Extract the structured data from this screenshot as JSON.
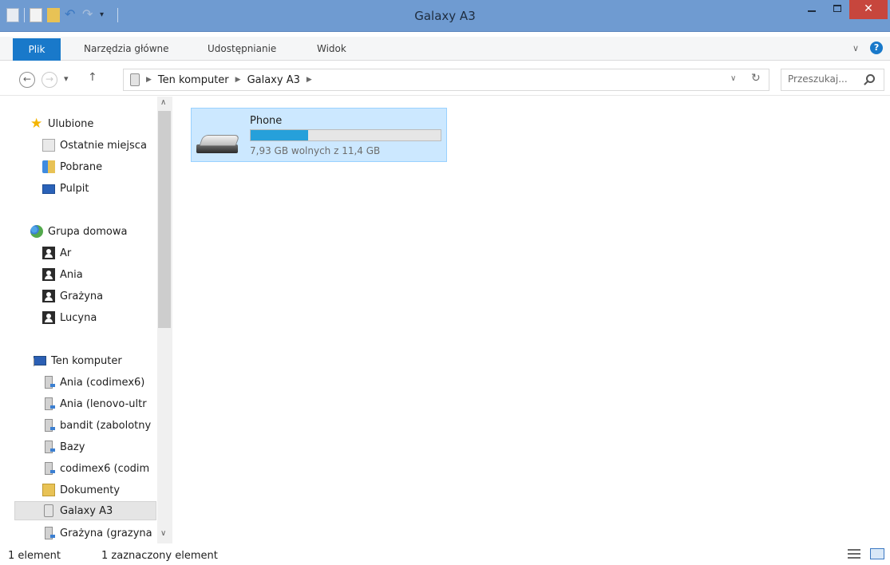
{
  "window": {
    "title": "Galaxy A3",
    "close_glyph": "✕"
  },
  "ribbon": {
    "file_tab": "Plik",
    "tabs": [
      "Narzędzia główne",
      "Udostępnianie",
      "Widok"
    ]
  },
  "navigation": {
    "back_glyph": "←",
    "forward_glyph": "→",
    "recent_glyph": "▾",
    "up_glyph": "↑",
    "breadcrumbs": [
      "Ten komputer",
      "Galaxy A3"
    ],
    "search_placeholder": "Przeszukaj..."
  },
  "sidebar": {
    "favorites": {
      "label": "Ulubione",
      "items": [
        "Ostatnie miejsca",
        "Pobrane",
        "Pulpit"
      ]
    },
    "homegroup": {
      "label": "Grupa domowa",
      "items": [
        "Ar",
        "Ania",
        "Grażyna",
        "Lucyna"
      ]
    },
    "computer": {
      "label": "Ten komputer",
      "items": [
        "Ania (codimex6)",
        "Ania (lenovo-ultr",
        "bandit (zabolotny",
        "Bazy",
        "codimex6 (codim",
        "Dokumenty",
        "Galaxy A3",
        "Grażyna (grazyna"
      ],
      "selected": "Galaxy A3"
    }
  },
  "content": {
    "drive": {
      "name": "Phone",
      "free_text": "7,93 GB wolnych z 11,4 GB",
      "used_fraction": 0.304
    }
  },
  "status_bar": {
    "count": "1 element",
    "selection": "1 zaznaczony element"
  },
  "colors": {
    "title_bar": "#6f9bd1",
    "file_tab": "#1979ca",
    "close_button": "#c7463d",
    "selection": "#cce8ff",
    "capacity_fill": "#26a0da"
  },
  "icons": {
    "favorites": "star-icon",
    "recent": "recent-places-icon",
    "downloads": "downloads-folder-icon",
    "desktop": "desktop-icon",
    "homegroup": "homegroup-icon",
    "user": "user-icon",
    "computer": "computer-icon",
    "network_drive": "network-drive-icon",
    "documents": "documents-icon",
    "phone": "phone-icon",
    "drive": "removable-drive-icon"
  }
}
